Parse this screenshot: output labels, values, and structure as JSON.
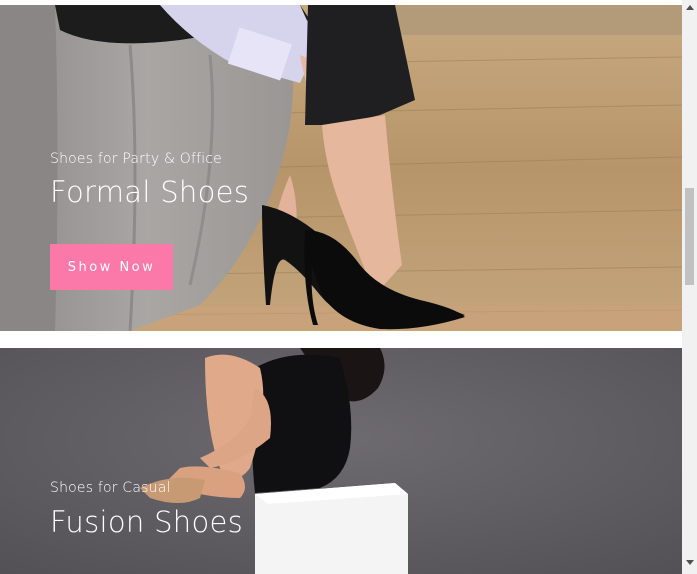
{
  "banners": [
    {
      "eyebrow": "Shoes for Party & Office",
      "title": "Formal Shoes",
      "cta_label": "Show Now",
      "image": "woman-in-black-heels-on-wooden-floor"
    },
    {
      "eyebrow": "Shoes for Casual",
      "title": "Fusion Shoes",
      "image": "woman-in-black-dress-sitting-on-white-cube"
    }
  ],
  "colors": {
    "cta": "#fb79a8",
    "banner2_bg": "#5f5c61",
    "floor": "#b99a71"
  },
  "scrollbar": {
    "up_icon": "triangle-up-icon",
    "down_icon": "triangle-down-icon"
  }
}
